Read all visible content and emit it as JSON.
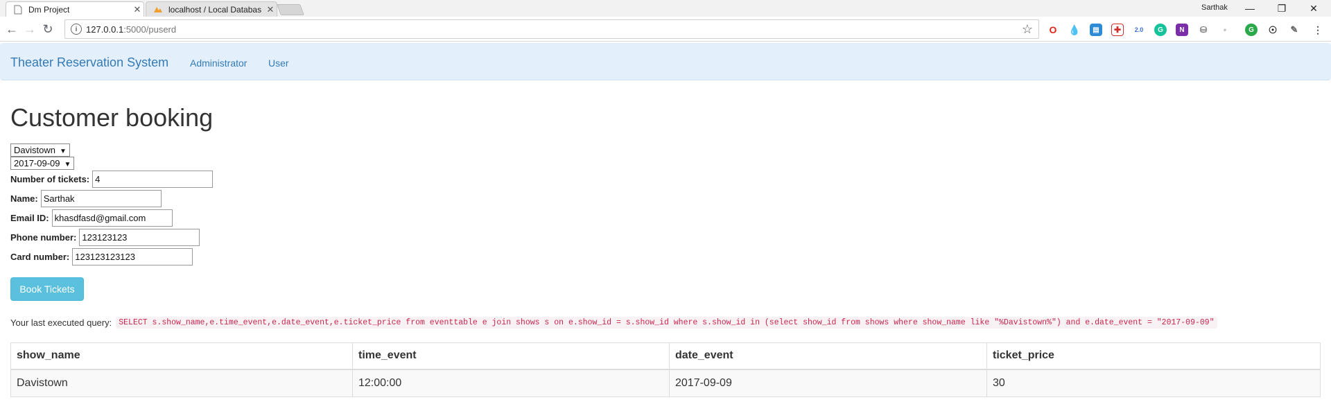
{
  "browser": {
    "tabs": [
      {
        "title": "Dm Project",
        "active": true
      },
      {
        "title": "localhost / Local Databas",
        "active": false
      }
    ],
    "profile_name": "Sarthak",
    "url_host": "127.0.0.1",
    "url_path": ":5000/puserd",
    "extensions": [
      {
        "icon": "opera-icon",
        "color": "#e0261b"
      },
      {
        "icon": "raindrop-icon",
        "color": "#1a6fd1"
      },
      {
        "icon": "window-icon",
        "color": "#2d8ad6"
      },
      {
        "icon": "puzzle-icon",
        "color": "#d02f2f"
      },
      {
        "icon": "badge-20-icon",
        "color": "#3b6fd6"
      },
      {
        "icon": "grammarly-icon",
        "color": "#15c39a"
      },
      {
        "icon": "onenote-icon",
        "color": "#7a2fa8"
      },
      {
        "icon": "database-icon",
        "color": "#777777"
      },
      {
        "icon": "dot-icon",
        "color": "#bbbbbb"
      },
      {
        "icon": "gmail-counter-icon",
        "color": "#2aa84a"
      },
      {
        "icon": "github-icon",
        "color": "#222222"
      },
      {
        "icon": "pen-icon",
        "color": "#666666"
      }
    ]
  },
  "navbar": {
    "brand": "Theater Reservation System",
    "links": [
      "Administrator",
      "User"
    ]
  },
  "page": {
    "title": "Customer booking",
    "show_select": "Davistown",
    "date_select": "2017-09-09",
    "fields": [
      {
        "label": "Number of tickets:",
        "value": "4"
      },
      {
        "label": "Name:",
        "value": "Sarthak"
      },
      {
        "label": "Email ID:",
        "value": "khasdfasd@gmail.com"
      },
      {
        "label": "Phone number:",
        "value": "123123123"
      },
      {
        "label": "Card number:",
        "value": "123123123123"
      }
    ],
    "submit_label": "Book Tickets",
    "query_label": "Your last executed query:",
    "query_text": "SELECT s.show_name,e.time_event,e.date_event,e.ticket_price from eventtable e join shows s on e.show_id = s.show_id where s.show_id in (select show_id from shows where show_name like \"%Davistown%\") and e.date_event = \"2017-09-09\""
  },
  "table": {
    "headers": [
      "show_name",
      "time_event",
      "date_event",
      "ticket_price"
    ],
    "rows": [
      [
        "Davistown",
        "12:00:00",
        "2017-09-09",
        "30"
      ]
    ]
  }
}
